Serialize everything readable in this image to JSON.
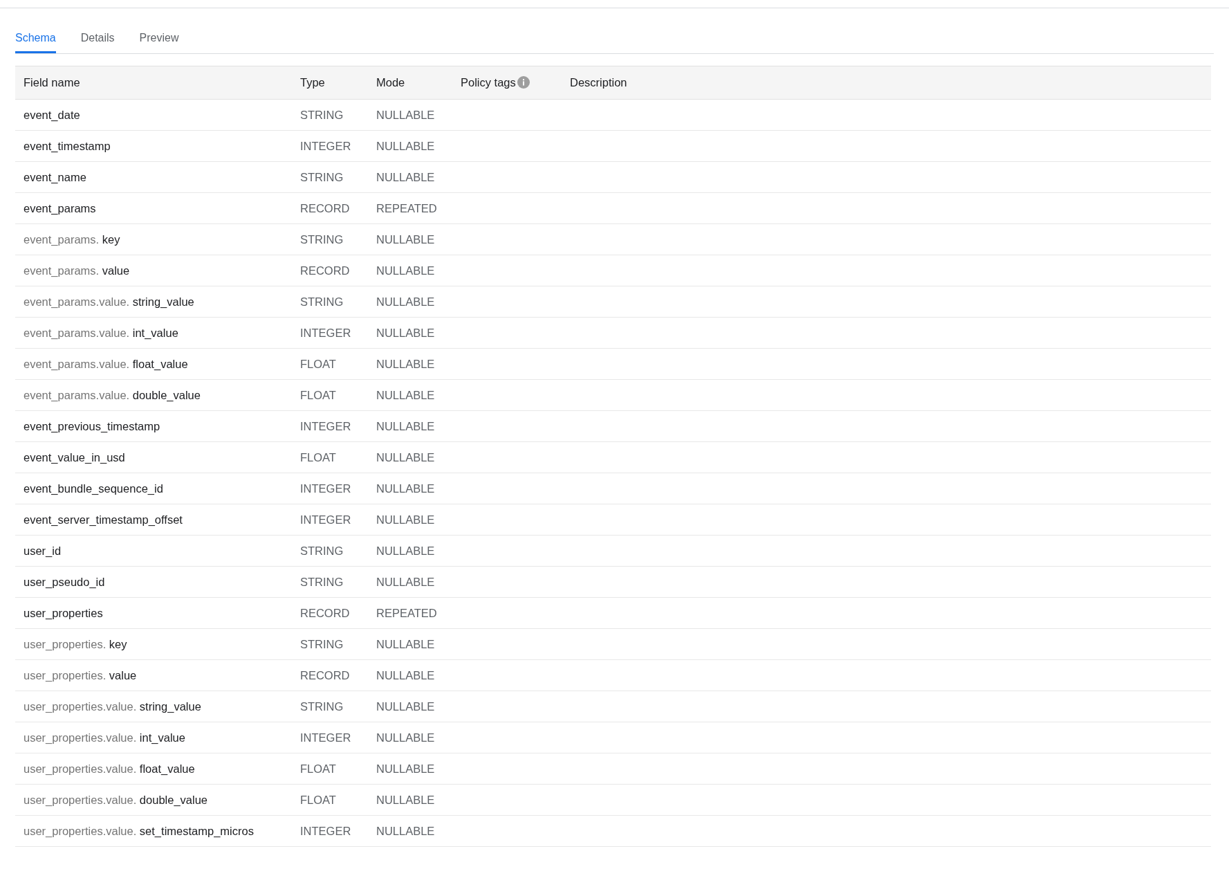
{
  "tabs": [
    {
      "label": "Schema",
      "selected": true
    },
    {
      "label": "Details",
      "selected": false
    },
    {
      "label": "Preview",
      "selected": false
    }
  ],
  "table": {
    "columns": [
      {
        "label": "Field name",
        "info": false
      },
      {
        "label": "Type",
        "info": false
      },
      {
        "label": "Mode",
        "info": false
      },
      {
        "label": "Policy tags",
        "info": true
      },
      {
        "label": "Description",
        "info": false
      }
    ],
    "rows": [
      {
        "name": "event_date",
        "type": "STRING",
        "mode": "NULLABLE"
      },
      {
        "name": "event_timestamp",
        "type": "INTEGER",
        "mode": "NULLABLE"
      },
      {
        "name": "event_name",
        "type": "STRING",
        "mode": "NULLABLE"
      },
      {
        "name": "event_params",
        "type": "RECORD",
        "mode": "REPEATED"
      },
      {
        "prefix": "event_params.",
        "name": "key",
        "type": "STRING",
        "mode": "NULLABLE"
      },
      {
        "prefix": "event_params.",
        "name": "value",
        "type": "RECORD",
        "mode": "NULLABLE"
      },
      {
        "prefix": "event_params.value.",
        "name": "string_value",
        "type": "STRING",
        "mode": "NULLABLE"
      },
      {
        "prefix": "event_params.value.",
        "name": "int_value",
        "type": "INTEGER",
        "mode": "NULLABLE"
      },
      {
        "prefix": "event_params.value.",
        "name": "float_value",
        "type": "FLOAT",
        "mode": "NULLABLE"
      },
      {
        "prefix": "event_params.value.",
        "name": "double_value",
        "type": "FLOAT",
        "mode": "NULLABLE"
      },
      {
        "name": "event_previous_timestamp",
        "type": "INTEGER",
        "mode": "NULLABLE"
      },
      {
        "name": "event_value_in_usd",
        "type": "FLOAT",
        "mode": "NULLABLE"
      },
      {
        "name": "event_bundle_sequence_id",
        "type": "INTEGER",
        "mode": "NULLABLE"
      },
      {
        "name": "event_server_timestamp_offset",
        "type": "INTEGER",
        "mode": "NULLABLE"
      },
      {
        "name": "user_id",
        "type": "STRING",
        "mode": "NULLABLE"
      },
      {
        "name": "user_pseudo_id",
        "type": "STRING",
        "mode": "NULLABLE"
      },
      {
        "name": "user_properties",
        "type": "RECORD",
        "mode": "REPEATED"
      },
      {
        "prefix": "user_properties.",
        "name": "key",
        "type": "STRING",
        "mode": "NULLABLE"
      },
      {
        "prefix": "user_properties.",
        "name": "value",
        "type": "RECORD",
        "mode": "NULLABLE"
      },
      {
        "prefix": "user_properties.value.",
        "name": "string_value",
        "type": "STRING",
        "mode": "NULLABLE"
      },
      {
        "prefix": "user_properties.value.",
        "name": "int_value",
        "type": "INTEGER",
        "mode": "NULLABLE"
      },
      {
        "prefix": "user_properties.value.",
        "name": "float_value",
        "type": "FLOAT",
        "mode": "NULLABLE"
      },
      {
        "prefix": "user_properties.value.",
        "name": "double_value",
        "type": "FLOAT",
        "mode": "NULLABLE"
      },
      {
        "prefix": "user_properties.value.",
        "name": "set_timestamp_micros",
        "type": "INTEGER",
        "mode": "NULLABLE"
      }
    ]
  }
}
